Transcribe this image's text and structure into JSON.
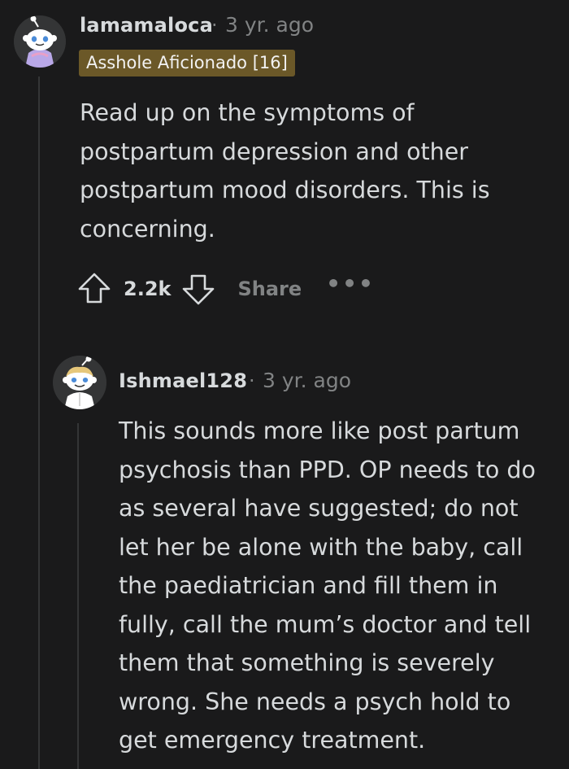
{
  "comment1": {
    "username": "lamamaloca",
    "separator": "·",
    "timestamp": "3 yr. ago",
    "flair": "Asshole Aficionado [16]",
    "body": "Read up on the symptoms of postpartum depression and other postpartum mood disorders. This is concerning.",
    "actions": {
      "upvote_icon": "arrow-up-outline-icon",
      "vote_count": "2.2k",
      "downvote_icon": "arrow-down-outline-icon",
      "share_label": "Share",
      "more_label": "•••"
    }
  },
  "comment2": {
    "username": "Ishmael128",
    "separator": "·",
    "timestamp": "3 yr. ago",
    "body": "This sounds more like post partum psychosis than PPD. OP needs to do as several have suggested; do not let her be alone with the baby, call the paediatrician and fill them in fully, call the mum’s doctor and tell them that something is severely wrong. She needs a psych hold to get emergency treatment."
  },
  "colors": {
    "background": "#1a1a1b",
    "text": "#d7dadc",
    "muted": "#818384",
    "flair_bg": "#6b5828",
    "thread_line": "#343536"
  }
}
